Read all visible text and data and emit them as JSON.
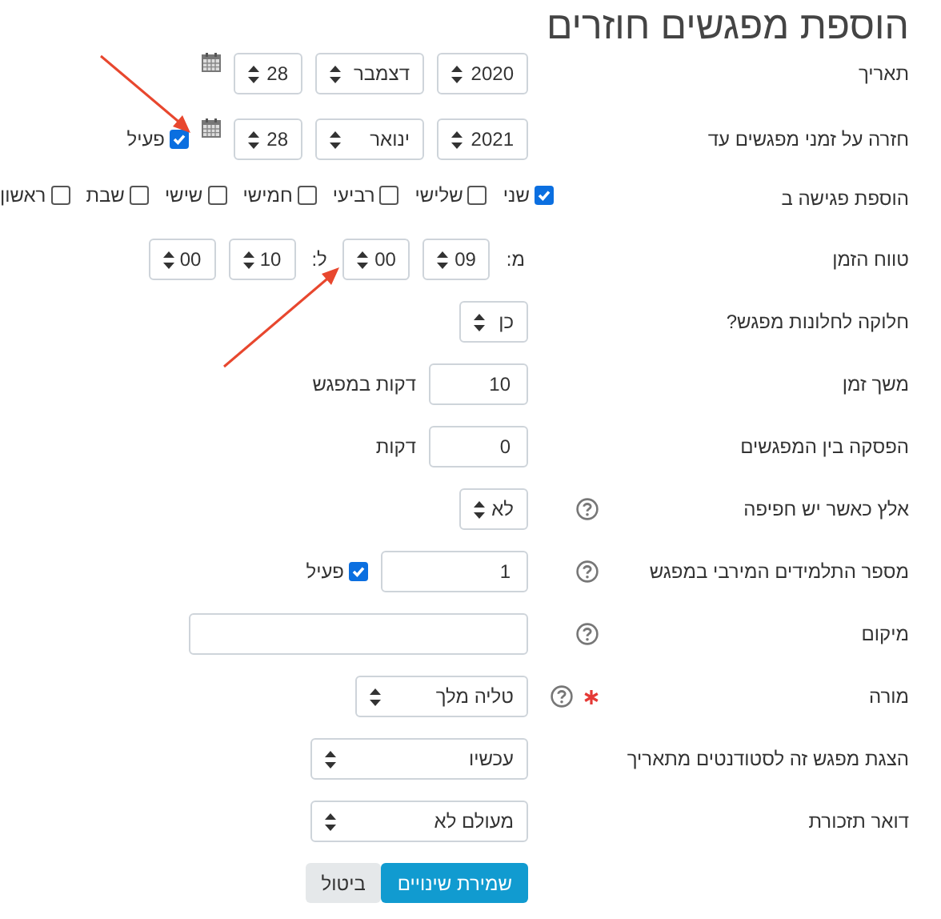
{
  "title": "הוספת מפגשים חוזרים",
  "fields": [
    {
      "kind": "date",
      "label": "תאריך",
      "selects": [
        "2020",
        "דצמבר",
        "28"
      ]
    },
    {
      "kind": "date",
      "label": "חזרה על זמני מפגשים עד",
      "selects": [
        "2021",
        "ינואר",
        "28"
      ],
      "enable": {
        "label": "פעיל",
        "checked": true
      }
    },
    {
      "kind": "weekdays",
      "label": "הוספת פגישה ב",
      "days": [
        {
          "label": "שני",
          "checked": true
        },
        {
          "label": "שלישי",
          "checked": false
        },
        {
          "label": "רביעי",
          "checked": false
        },
        {
          "label": "חמישי",
          "checked": false
        },
        {
          "label": "שישי",
          "checked": false
        },
        {
          "label": "שבת",
          "checked": false
        },
        {
          "label": "ראשון",
          "checked": false
        }
      ]
    },
    {
      "kind": "timerange",
      "label": "טווח הזמן",
      "from_label": "מ:",
      "from": [
        "09",
        "00"
      ],
      "to_label": "ל:",
      "to": [
        "10",
        "00"
      ]
    },
    {
      "kind": "select",
      "label": "חלוקה לחלונות מפגש?",
      "value": "כן"
    },
    {
      "kind": "number",
      "label": "משך זמן",
      "value": "10",
      "unit": "דקות במפגש"
    },
    {
      "kind": "number",
      "label": "הפסקה בין המפגשים",
      "value": "0",
      "unit": "דקות"
    },
    {
      "kind": "select",
      "label": "אלץ כאשר יש חפיפה",
      "help": true,
      "value": "לא"
    },
    {
      "kind": "number",
      "label": "מספר התלמידים המירבי במפגש",
      "help": true,
      "value": "1",
      "enable": {
        "label": "פעיל",
        "checked": true
      }
    },
    {
      "kind": "text",
      "label": "מיקום",
      "help": true
    },
    {
      "kind": "select",
      "label": "מורה",
      "help": true,
      "required": true,
      "value": "טליה מלך"
    },
    {
      "kind": "select",
      "label": "הצגת מפגש זה לסטודנטים מתאריך",
      "value": "עכשיו"
    },
    {
      "kind": "select",
      "label": "דואר תזכורת",
      "value": "מעולם לא"
    }
  ],
  "buttons": [
    {
      "label": "שמירת שינויים",
      "kind": "primary"
    },
    {
      "label": "ביטול",
      "kind": "secondary"
    }
  ]
}
